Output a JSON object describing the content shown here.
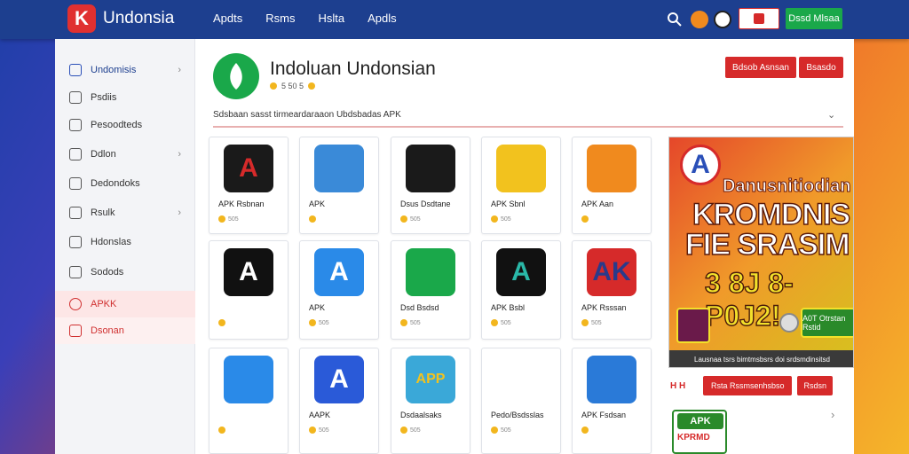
{
  "brand": {
    "name": "Undonsia",
    "logo_letter": "K"
  },
  "nav": [
    "Apdts",
    "Rsms",
    "Hslta",
    "Apdls"
  ],
  "top_buttons": {
    "secondary": "",
    "primary": "Dssd Mlsaa"
  },
  "sidebar": {
    "items": [
      {
        "label": "Undomisis",
        "chevron": "›"
      },
      {
        "label": "Psdiis"
      },
      {
        "label": "Pesoodteds"
      },
      {
        "label": "Ddlon",
        "chevron": "›"
      },
      {
        "label": "Dedondoks"
      },
      {
        "label": "Rsulk",
        "chevron": "›"
      },
      {
        "label": "Hdonslas"
      },
      {
        "label": "Sodods"
      },
      {
        "label": "APKK"
      },
      {
        "label": "Dsonan"
      }
    ]
  },
  "header": {
    "title": "Indoluan Undonsian",
    "rating_text": "5 50 5",
    "buttons": [
      "Bdsob Asnsan",
      "Bsasdo"
    ],
    "subheading": "Sdsbaan sasst tirmeardaraaon Ubdsbadas APK",
    "subheading_chevron": "⌄"
  },
  "apps": [
    {
      "name": "APK Rsbnan",
      "meta": "505",
      "icon_letter": "A",
      "color": "#1a1a1a",
      "accent": "#d62a2a"
    },
    {
      "name": "APK",
      "meta": "",
      "icon_letter": "",
      "color": "#3a8ad8",
      "accent": "#e8452a"
    },
    {
      "name": "Dsus Dsdtane",
      "meta": "505",
      "icon_letter": "",
      "color": "#1a1a1a",
      "accent": "#2a7ad8"
    },
    {
      "name": "APK Sbnl",
      "meta": "505",
      "icon_letter": "",
      "color": "#f2c21e",
      "accent": "#d62a2a"
    },
    {
      "name": "APK Aan",
      "meta": "",
      "icon_letter": "",
      "color": "#f08a1e",
      "accent": "#888888"
    },
    {
      "name": "",
      "meta": "",
      "icon_letter": "A",
      "color": "#111111",
      "accent": "#ffffff"
    },
    {
      "name": "APK",
      "meta": "505",
      "icon_letter": "A",
      "color": "#2a8ae8",
      "accent": "#ffffff"
    },
    {
      "name": "Dsd Bsdsd",
      "meta": "505",
      "icon_letter": "",
      "color": "#1aa84a",
      "accent": "#d62a2a"
    },
    {
      "name": "APK Bsbl",
      "meta": "505",
      "icon_letter": "A",
      "color": "#111111",
      "accent": "#2ab8a8"
    },
    {
      "name": "APK Rsssan",
      "meta": "505",
      "icon_letter": "AK",
      "color": "#d62a2a",
      "accent": "#2a3a8a"
    },
    {
      "name": "",
      "meta": "",
      "icon_letter": "",
      "color": "#2a8ae8",
      "accent": "#d62a2a"
    },
    {
      "name": "AAPK",
      "meta": "505",
      "icon_letter": "A",
      "color": "#2a5ad8",
      "accent": "#ffffff"
    },
    {
      "name": "Dsdaalsaks",
      "meta": "505",
      "icon_letter": "APP",
      "color": "#3aa8d8",
      "accent": "#f2c21e"
    },
    {
      "name": "Pedo/Bsdsslas",
      "meta": "505",
      "icon_letter": "",
      "color": "#ffffff",
      "accent": "#1aa84a"
    },
    {
      "name": "APK Fsdsan",
      "meta": "",
      "icon_letter": "",
      "color": "#2a7ad8",
      "accent": "#5ab8f8"
    }
  ],
  "promo": {
    "line1": "Danusnitiodian",
    "line2": "KROMDNIS",
    "line3": "FIE SRASIM",
    "line4": "3 8J 8-P0J2!",
    "cta": "A0T Otrstan Rstid",
    "footer": "Lausnaa tsrs bimtmsbsrs doi srdsmdinsitsd"
  },
  "side_actions": {
    "label": "Rsta Rssmsenhsbso",
    "small": "Rsdsn",
    "icons": "H H"
  },
  "green_card": {
    "top": "APK",
    "bottom": "KPRMD"
  },
  "right_chevron": "›"
}
